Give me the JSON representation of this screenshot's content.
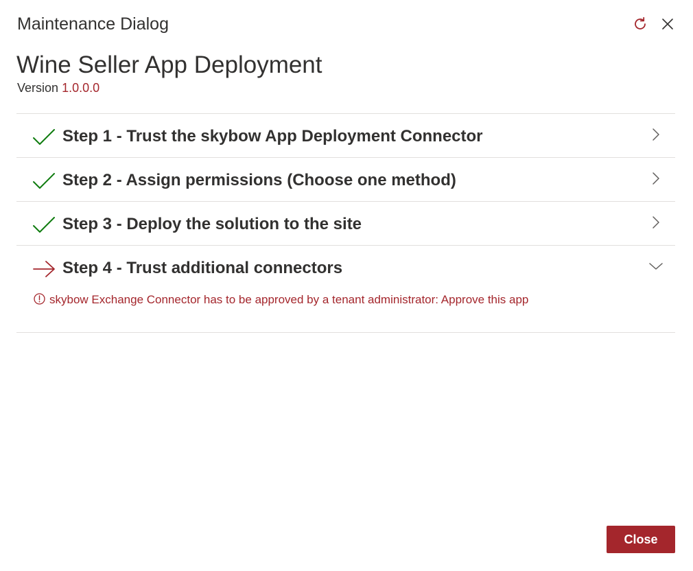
{
  "dialog": {
    "title": "Maintenance Dialog",
    "icons": {
      "refresh": "refresh-icon",
      "close": "close-icon"
    }
  },
  "app": {
    "title": "Wine Seller App Deployment",
    "version_label": "Version",
    "version_value": "1.0.0.0"
  },
  "steps": [
    {
      "label": "Step 1 - Trust the skybow App Deployment Connector",
      "status": "done"
    },
    {
      "label": "Step 2 - Assign permissions (Choose one method)",
      "status": "done"
    },
    {
      "label": "Step 3 - Deploy the solution to the site",
      "status": "done"
    },
    {
      "label": "Step 4 - Trust additional connectors",
      "status": "current"
    }
  ],
  "step4_message": "skybow Exchange Connector has to be approved by a tenant administrator: Approve this app",
  "footer": {
    "close_label": "Close"
  },
  "colors": {
    "accent": "#a4262c",
    "success": "#107c10",
    "text": "#323130",
    "divider": "#e1dfdd"
  }
}
